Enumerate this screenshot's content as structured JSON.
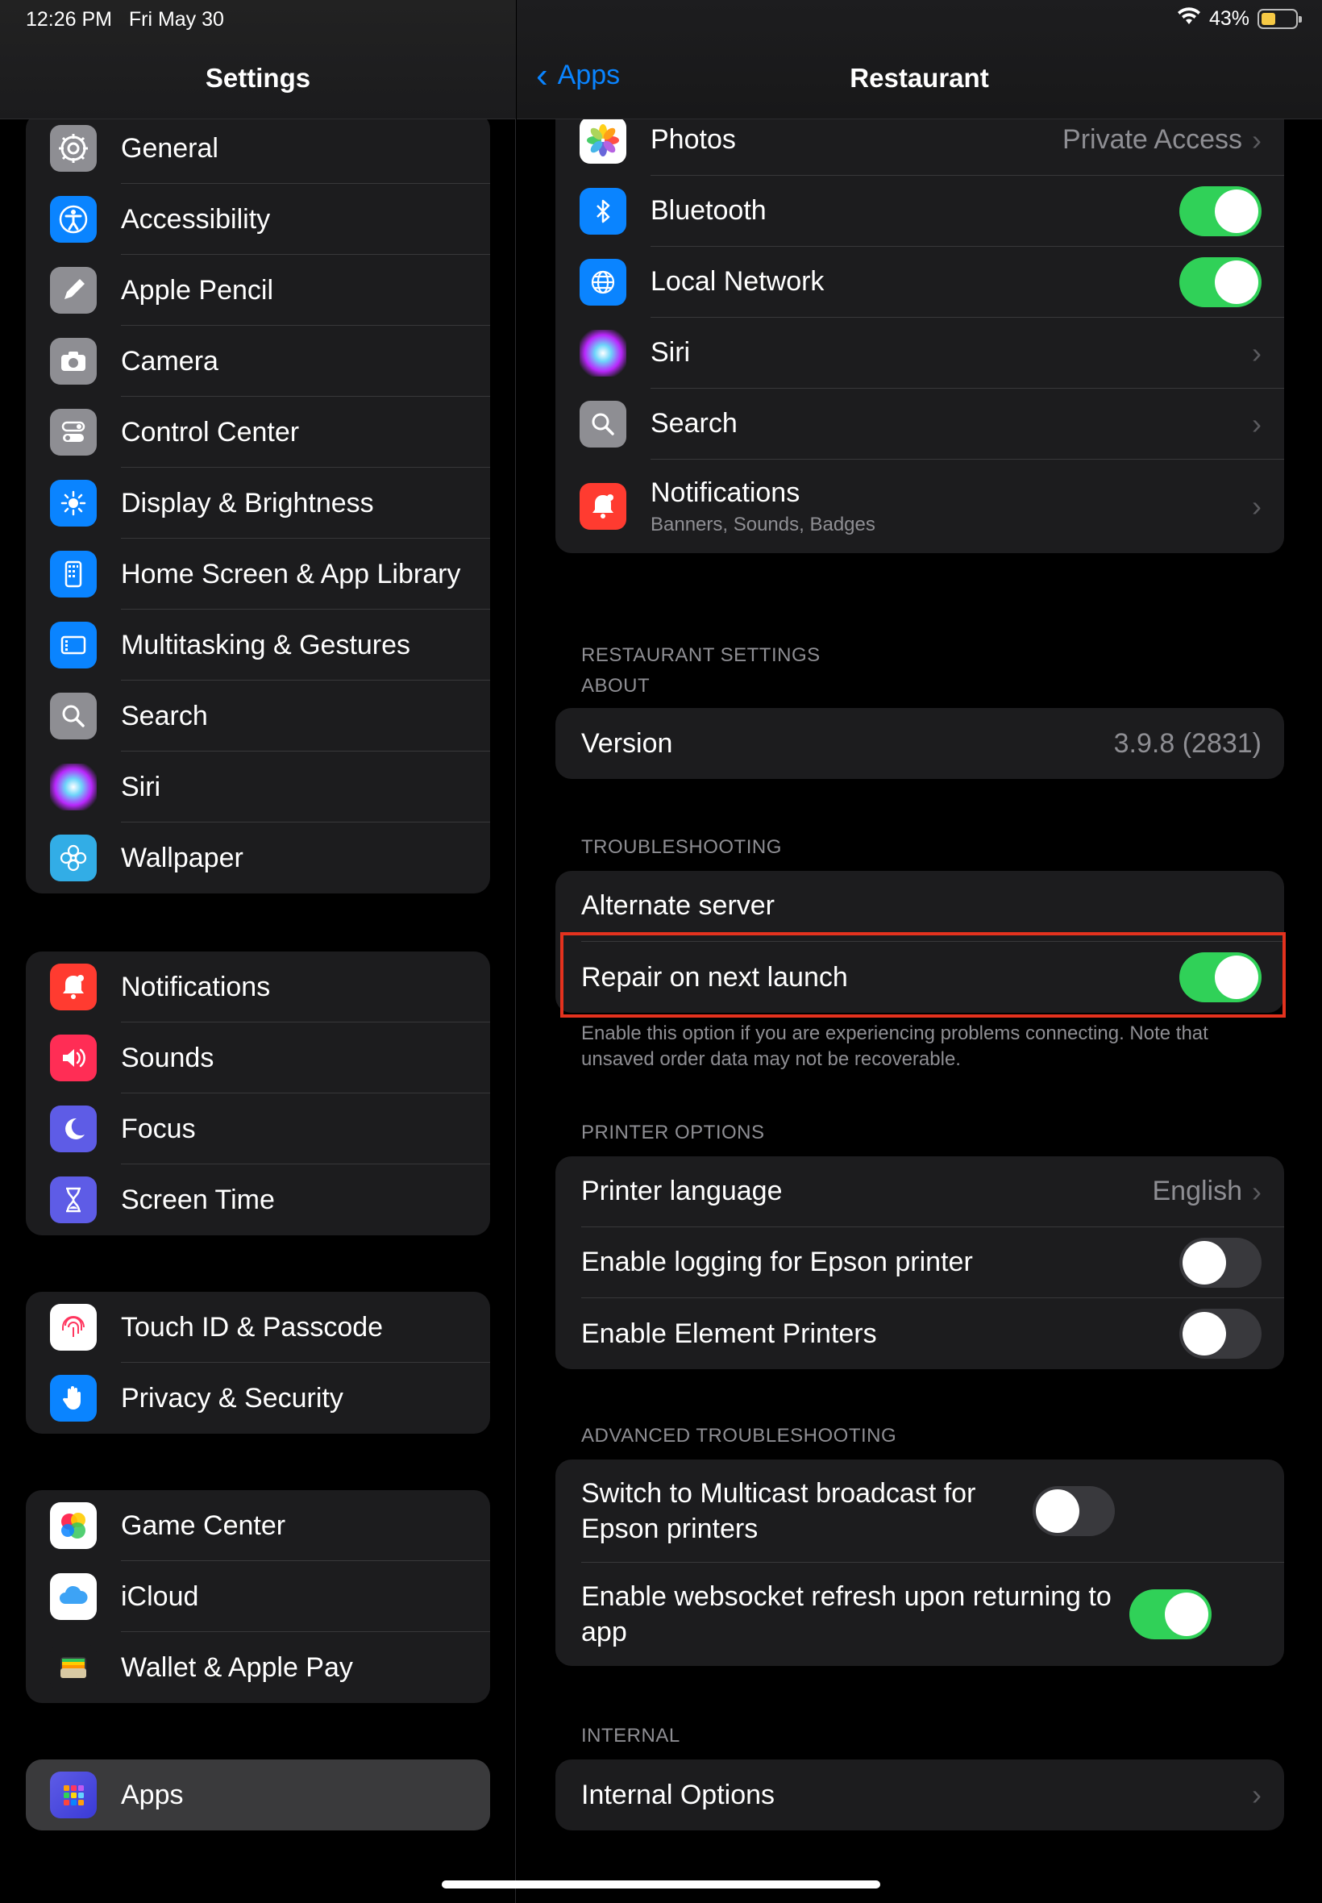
{
  "status": {
    "time": "12:26 PM",
    "date": "Fri May 30",
    "battery": "43%",
    "battery_level": 0.43,
    "icons": [
      "wifi-icon",
      "battery-icon"
    ]
  },
  "left": {
    "title": "Settings",
    "group1": [
      {
        "label": "General",
        "icon": "gear-icon"
      },
      {
        "label": "Accessibility",
        "icon": "accessibility-icon"
      },
      {
        "label": "Apple Pencil",
        "icon": "pencil-icon"
      },
      {
        "label": "Camera",
        "icon": "camera-icon"
      },
      {
        "label": "Control Center",
        "icon": "toggles-icon"
      },
      {
        "label": "Display & Brightness",
        "icon": "sun-icon"
      },
      {
        "label": "Home Screen & App Library",
        "icon": "home-screen-icon"
      },
      {
        "label": "Multitasking & Gestures",
        "icon": "multitasking-icon"
      },
      {
        "label": "Search",
        "icon": "search-icon"
      },
      {
        "label": "Siri",
        "icon": "siri-icon"
      },
      {
        "label": "Wallpaper",
        "icon": "flower-icon"
      }
    ],
    "group2": [
      {
        "label": "Notifications",
        "icon": "bell-icon"
      },
      {
        "label": "Sounds",
        "icon": "speaker-icon"
      },
      {
        "label": "Focus",
        "icon": "moon-icon"
      },
      {
        "label": "Screen Time",
        "icon": "hourglass-icon"
      }
    ],
    "group3": [
      {
        "label": "Touch ID & Passcode",
        "icon": "fingerprint-icon"
      },
      {
        "label": "Privacy & Security",
        "icon": "hand-icon"
      }
    ],
    "group4": [
      {
        "label": "Game Center",
        "icon": "game-center-icon"
      },
      {
        "label": "iCloud",
        "icon": "cloud-icon"
      },
      {
        "label": "Wallet & Apple Pay",
        "icon": "wallet-icon"
      }
    ],
    "group5": [
      {
        "label": "Apps",
        "icon": "apps-grid-icon",
        "selected": true
      }
    ]
  },
  "right": {
    "back_label": "Apps",
    "title": "Restaurant",
    "permissions": {
      "photos_label": "Photos",
      "photos_value": "Private Access",
      "bluetooth_label": "Bluetooth",
      "bluetooth_on": true,
      "local_network_label": "Local Network",
      "local_network_on": true,
      "siri_label": "Siri",
      "search_label": "Search",
      "notifications_label": "Notifications",
      "notifications_sub": "Banners, Sounds, Badges"
    },
    "restaurant_settings_header": "RESTAURANT SETTINGS",
    "about_header": "ABOUT",
    "version_label": "Version",
    "version_value": "3.9.8 (2831)",
    "troubleshooting_header": "TROUBLESHOOTING",
    "alternate_server_label": "Alternate server",
    "repair_label": "Repair on next launch",
    "repair_on": true,
    "troubleshooting_footnote": "Enable this option if you are experiencing problems connecting. Note that unsaved order data may not be recoverable.",
    "printer_header": "PRINTER OPTIONS",
    "printer_language_label": "Printer language",
    "printer_language_value": "English",
    "epson_logging_label": "Enable logging for Epson printer",
    "epson_logging_on": false,
    "element_printers_label": "Enable Element Printers",
    "element_printers_on": false,
    "advanced_header": "ADVANCED TROUBLESHOOTING",
    "multicast_label": "Switch to Multicast broadcast for Epson printers",
    "multicast_on": false,
    "websocket_label": "Enable websocket refresh upon returning to app",
    "websocket_on": true,
    "internal_header": "INTERNAL",
    "internal_options_label": "Internal Options"
  },
  "colors": {
    "accent": "#0a84ff",
    "toggle_on": "#30d158",
    "highlight": "#e4321e"
  }
}
